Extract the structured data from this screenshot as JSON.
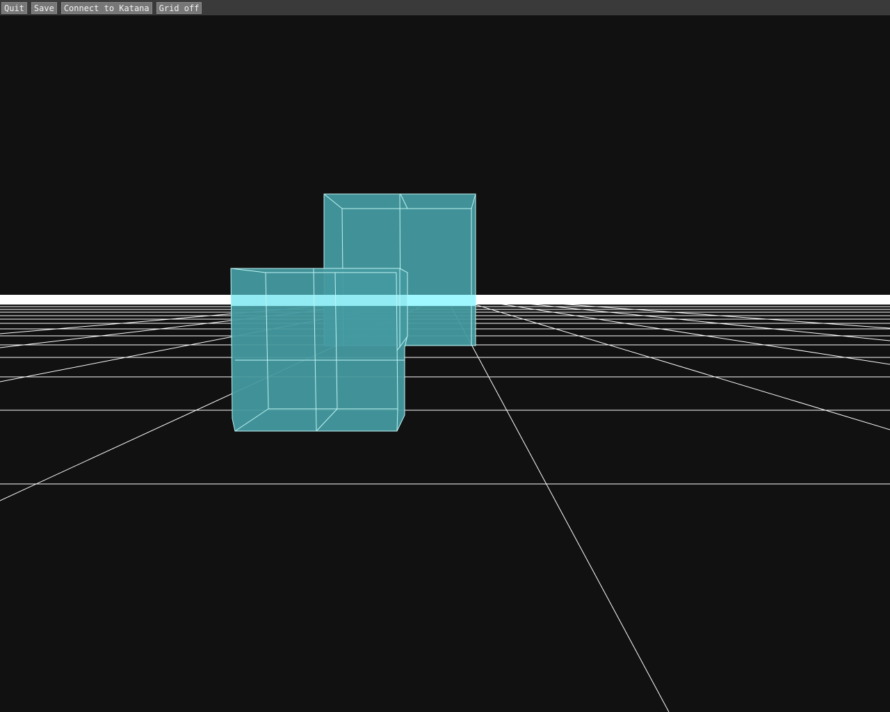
{
  "toolbar": {
    "quit_label": "Quit",
    "save_label": "Save",
    "connect_label": "Connect to Katana",
    "grid_label": "Grid off"
  },
  "viewport": {
    "background_color": "#111111",
    "grid_color": "#ffffff",
    "box_fill_color": "#449aa0",
    "box_edge_color": "#bff4f4",
    "horizon_glow_color": "#9ff8ff",
    "objects": [
      {
        "name": "cube-back",
        "type": "box"
      },
      {
        "name": "cube-front",
        "type": "box"
      }
    ]
  }
}
